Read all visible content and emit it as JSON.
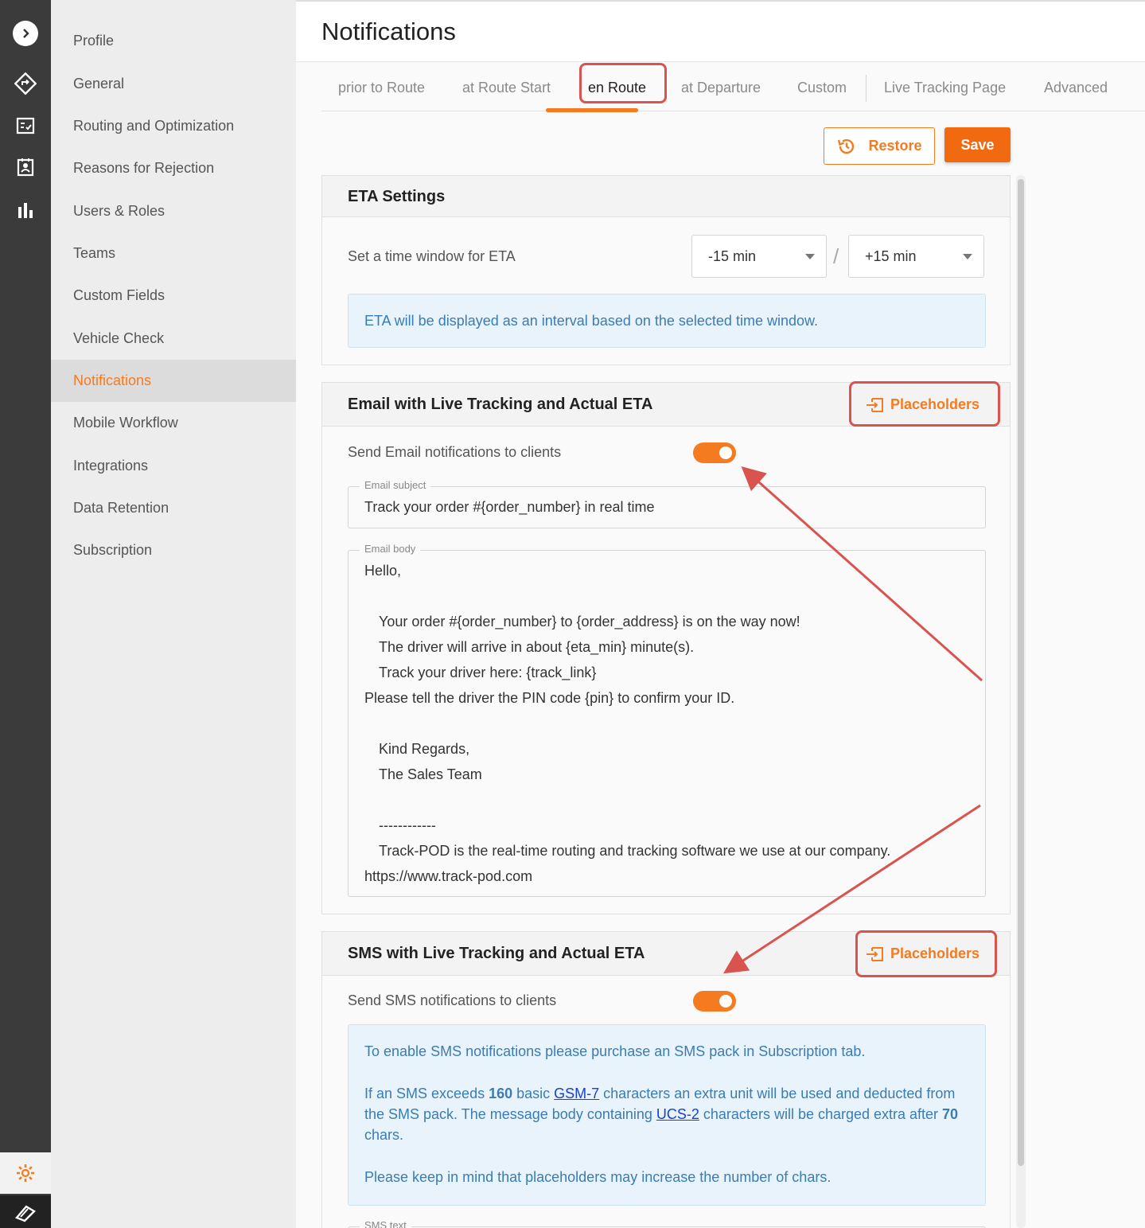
{
  "header": {
    "title": "Notifications"
  },
  "sidebar": {
    "items": [
      {
        "label": "Profile"
      },
      {
        "label": "General"
      },
      {
        "label": "Routing and Optimization"
      },
      {
        "label": "Reasons for Rejection"
      },
      {
        "label": "Users & Roles"
      },
      {
        "label": "Teams"
      },
      {
        "label": "Custom Fields"
      },
      {
        "label": "Vehicle Check"
      },
      {
        "label": "Notifications"
      },
      {
        "label": "Mobile Workflow"
      },
      {
        "label": "Integrations"
      },
      {
        "label": "Data Retention"
      },
      {
        "label": "Subscription"
      }
    ],
    "active": "Notifications"
  },
  "tabs": [
    {
      "label": "prior to Route"
    },
    {
      "label": "at Route Start"
    },
    {
      "label": "en Route"
    },
    {
      "label": "at Departure"
    },
    {
      "label": "Custom"
    },
    {
      "label": "Live Tracking Page"
    },
    {
      "label": "Advanced"
    }
  ],
  "active_tab": "en Route",
  "toolbar": {
    "restore_label": "Restore",
    "save_label": "Save"
  },
  "eta": {
    "title": "ETA Settings",
    "window_label": "Set a time window for ETA",
    "min_value": "-15 min",
    "separator": "/",
    "max_value": "+15 min",
    "info": "ETA will be displayed as an interval based on the selected time window."
  },
  "email": {
    "title": "Email with Live Tracking and Actual ETA",
    "placeholders_label": "Placeholders",
    "toggle_label": "Send Email notifications to clients",
    "subject_label": "Email subject",
    "subject": "Track your order #{order_number} in real time",
    "body_label": "Email body",
    "body_lines": [
      "Hello,",
      "Your order #{order_number} to {order_address} is on the way now!",
      "The driver will arrive in about {eta_min} minute(s).",
      "Track your driver here: {track_link}",
      "Please tell the driver the PIN code {pin} to confirm your ID.",
      "Kind Regards,",
      "The Sales Team",
      "------------",
      "Track-POD is the real-time routing and tracking software we use at our company.",
      "https://www.track-pod.com"
    ]
  },
  "sms": {
    "title": "SMS with Live Tracking and Actual ETA",
    "placeholders_label": "Placeholders",
    "toggle_label": "Send SMS notifications to clients",
    "info_line1": "To enable SMS notifications please purchase an SMS pack in Subscription tab.",
    "info_p2_a": "If an SMS exceeds ",
    "info_p2_num1": "160",
    "info_p2_b": " basic ",
    "info_p2_link1": "GSM-7",
    "info_p2_c": " characters an extra unit will be used and deducted from the SMS pack. The message body containing ",
    "info_p2_link2": "UCS-2",
    "info_p2_d": " characters will be charged extra after ",
    "info_p2_num2": "70",
    "info_p2_e": " chars.",
    "info_line3": "Please keep in mind that placeholders may increase the number of chars.",
    "text_label": "SMS text"
  },
  "colors": {
    "accent": "#f47b20",
    "annotation": "#d9534f",
    "info_text": "#3a7cb3"
  }
}
